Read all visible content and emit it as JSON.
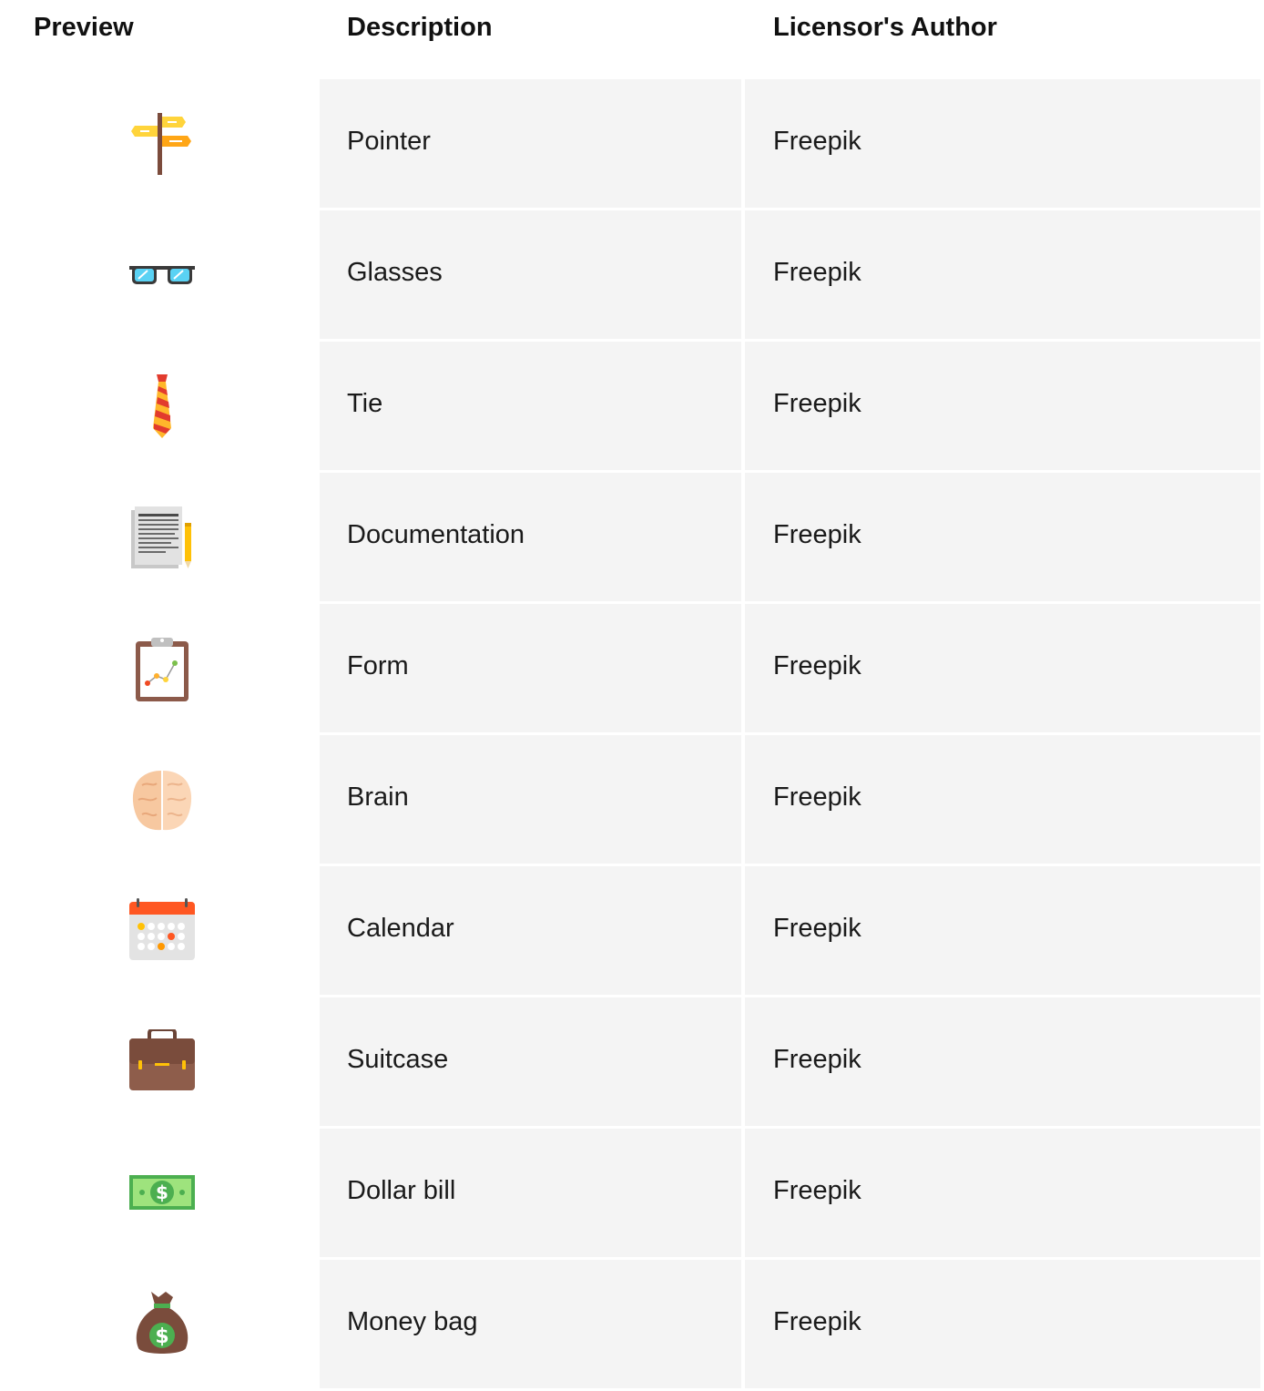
{
  "headers": {
    "preview": "Preview",
    "description": "Description",
    "author": "Licensor's Author"
  },
  "rows": [
    {
      "icon": "signpost-icon",
      "description": "Pointer",
      "author": "Freepik"
    },
    {
      "icon": "glasses-icon",
      "description": "Glasses",
      "author": "Freepik"
    },
    {
      "icon": "tie-icon",
      "description": "Tie",
      "author": "Freepik"
    },
    {
      "icon": "documentation-icon",
      "description": "Documentation",
      "author": "Freepik"
    },
    {
      "icon": "clipboard-chart-icon",
      "description": "Form",
      "author": "Freepik"
    },
    {
      "icon": "brain-icon",
      "description": "Brain",
      "author": "Freepik"
    },
    {
      "icon": "calendar-icon",
      "description": "Calendar",
      "author": "Freepik"
    },
    {
      "icon": "suitcase-icon",
      "description": "Suitcase",
      "author": "Freepik"
    },
    {
      "icon": "dollar-bill-icon",
      "description": "Dollar bill",
      "author": "Freepik"
    },
    {
      "icon": "money-bag-icon",
      "description": "Money bag",
      "author": "Freepik"
    }
  ],
  "colors": {
    "cell_background": "#f4f4f4",
    "text": "#1a1a1a"
  }
}
